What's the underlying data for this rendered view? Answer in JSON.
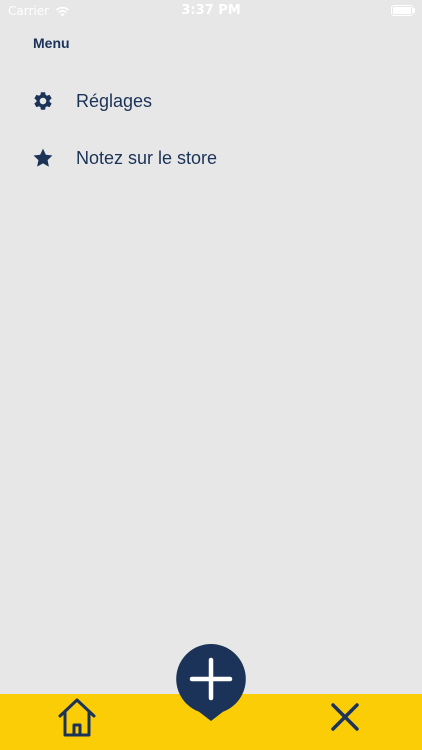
{
  "status_bar": {
    "carrier": "Carrier",
    "time": "3:37 PM"
  },
  "menu": {
    "title": "Menu",
    "items": [
      {
        "label": "Réglages",
        "icon": "gear-icon"
      },
      {
        "label": "Notez sur le store",
        "icon": "star-icon"
      }
    ]
  },
  "bottom_bar": {
    "home_icon": "home-icon",
    "add_icon": "plus-icon",
    "close_icon": "close-icon"
  },
  "colors": {
    "background": "#e7e7e7",
    "accent_navy": "#1b3358",
    "bottom_bar_yellow": "#fbcd06",
    "status_text": "#ffffff"
  }
}
